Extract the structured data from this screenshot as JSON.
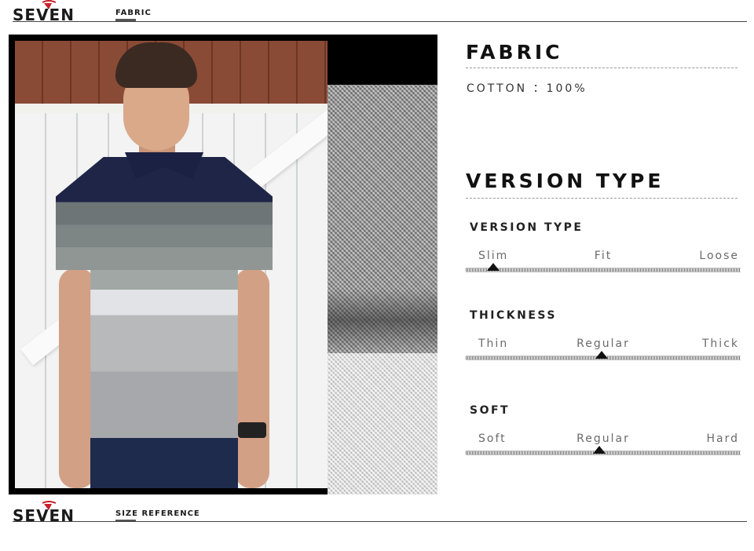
{
  "header": {
    "brand": "SEVEN",
    "section_tag": "FABRIC"
  },
  "footer": {
    "brand": "SEVEN",
    "section_tag": "SIZE REFERENCE"
  },
  "fabric": {
    "title": "FABRIC",
    "composition_label": "COTTON",
    "composition_value": "：100%"
  },
  "version_type": {
    "title": "VERSION TYPE",
    "scales": [
      {
        "label": "VERSION TYPE",
        "options": [
          "Slim",
          "Fit",
          "Loose"
        ],
        "selected_index": 0,
        "position": 0.1
      },
      {
        "label": "THICKNESS",
        "options": [
          "Thin",
          "Regular",
          "Thick"
        ],
        "selected_index": 1,
        "position": 0.495
      },
      {
        "label": "SOFT",
        "options": [
          "Soft",
          "Regular",
          "Hard"
        ],
        "selected_index": 1,
        "position": 0.487
      }
    ]
  },
  "colors": {
    "accent_red": "#c8202a",
    "shirt_navy": "#1e2547"
  },
  "icons": {
    "brand_logo": "seven-logo-icon",
    "scale_marker": "triangle-up-icon"
  }
}
